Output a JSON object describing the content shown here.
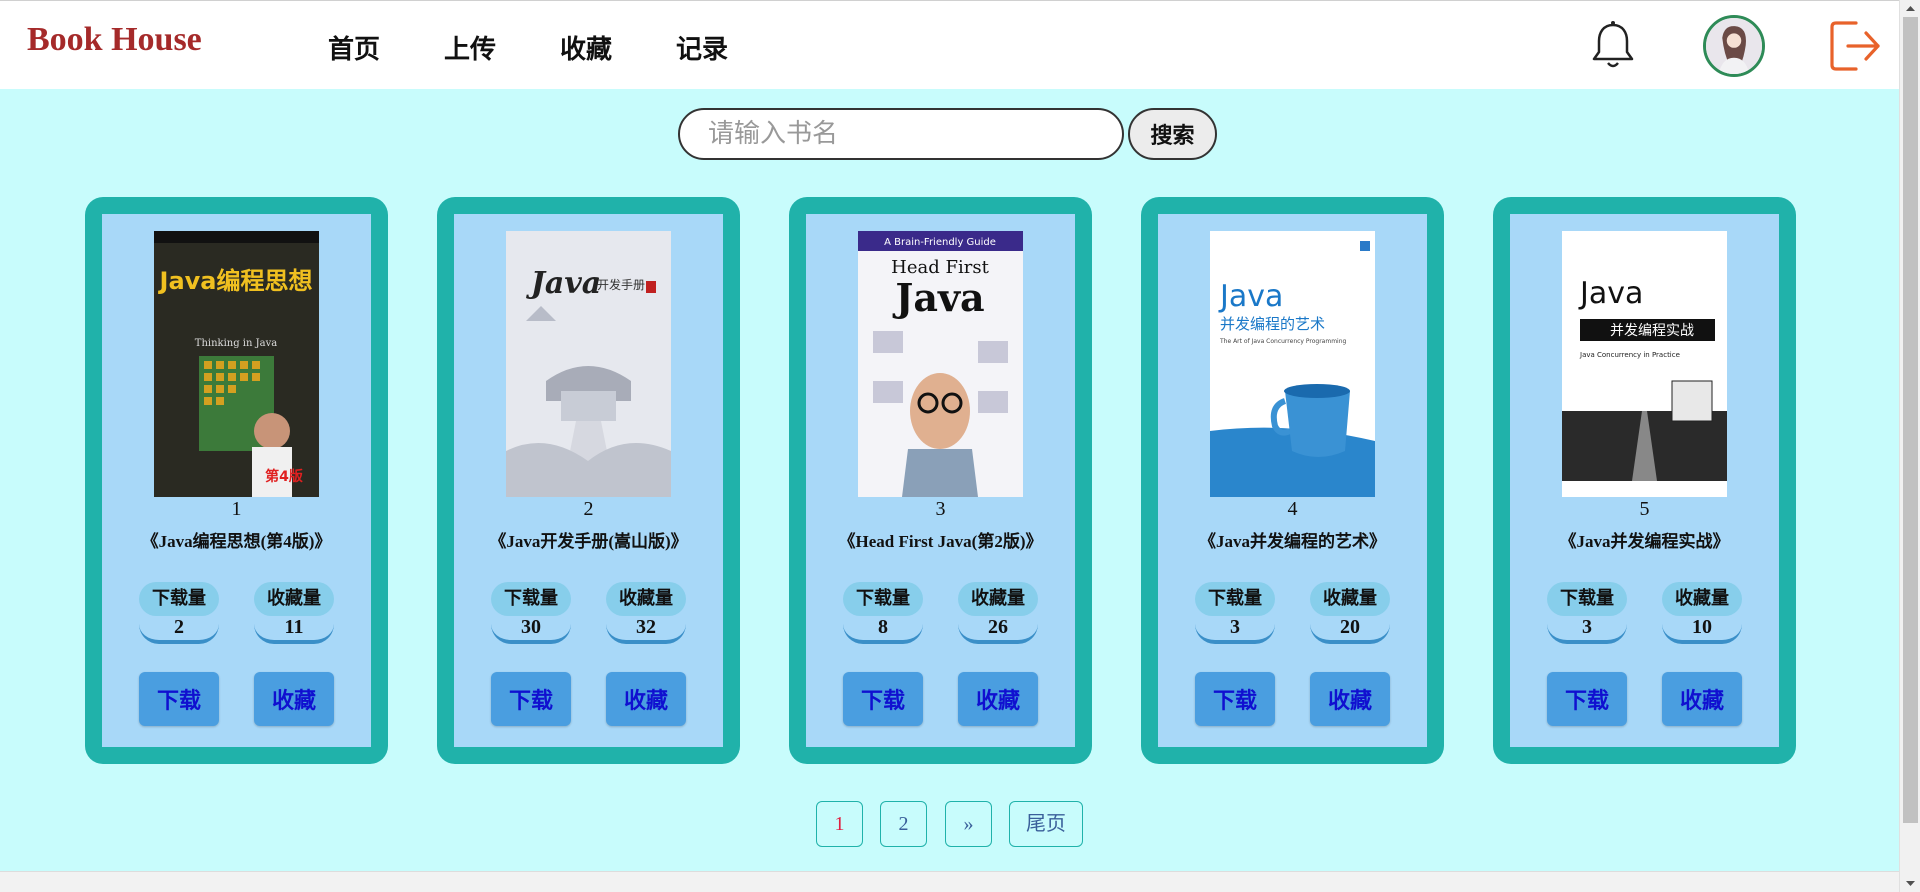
{
  "header": {
    "logo": "Book House",
    "nav": [
      "首页",
      "上传",
      "收藏",
      "记录"
    ]
  },
  "search": {
    "placeholder": "请输入书名",
    "button": "搜索"
  },
  "labels": {
    "downloads": "下载量",
    "favorites": "收藏量",
    "download_btn": "下载",
    "favorite_btn": "收藏"
  },
  "books": [
    {
      "num": "1",
      "title": "《Java编程思想(第4版)》",
      "downloads": "2",
      "favorites": "11"
    },
    {
      "num": "2",
      "title": "《Java开发手册(嵩山版)》",
      "downloads": "30",
      "favorites": "32"
    },
    {
      "num": "3",
      "title": "《Head First Java(第2版)》",
      "downloads": "8",
      "favorites": "26"
    },
    {
      "num": "4",
      "title": "《Java并发编程的艺术》",
      "downloads": "3",
      "favorites": "20"
    },
    {
      "num": "5",
      "title": "《Java并发编程实战》",
      "downloads": "3",
      "favorites": "10"
    }
  ],
  "covers": [
    {
      "main": "Java编程思想",
      "sub": "Thinking in Java",
      "badge": "第4版"
    },
    {
      "main": "Java",
      "sub": "开发手册"
    },
    {
      "top": "A Brain-Friendly Guide",
      "main": "Head First",
      "sub": "Java"
    },
    {
      "main": "Java",
      "sub": "并发编程的艺术",
      "en": "The Art of Java Concurrency Programming"
    },
    {
      "main": "Java",
      "sub": "并发编程实战",
      "en": "Java Concurrency in Practice"
    }
  ],
  "pager": {
    "p1": "1",
    "p2": "2",
    "next": "»",
    "last": "尾页"
  },
  "colors": {
    "logo": "#a52a2a",
    "background": "#c8fcfc",
    "card_border": "#20b2aa",
    "card_inner": "#a8d8f8",
    "button": "#4a9ee0",
    "logout": "#e8622a"
  }
}
